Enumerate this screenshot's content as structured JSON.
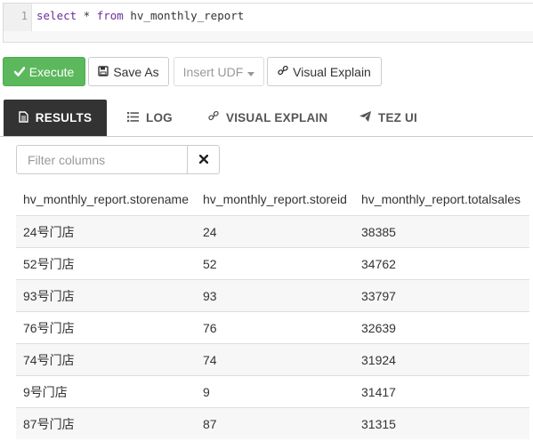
{
  "editor": {
    "line_number": "1",
    "tokens": {
      "select": "select",
      "star": " * ",
      "from": "from",
      "table": " hv_monthly_report"
    }
  },
  "toolbar": {
    "execute_label": "Execute",
    "save_as_label": "Save As",
    "insert_udf_label": "Insert UDF",
    "visual_explain_label": "Visual Explain"
  },
  "tabs": [
    {
      "label": "RESULTS",
      "active": true
    },
    {
      "label": "LOG"
    },
    {
      "label": "VISUAL EXPLAIN"
    },
    {
      "label": "TEZ UI"
    }
  ],
  "filter": {
    "placeholder": "Filter columns"
  },
  "table": {
    "headers": [
      "hv_monthly_report.storename",
      "hv_monthly_report.storeid",
      "hv_monthly_report.totalsales"
    ],
    "rows": [
      [
        "24号门店",
        "24",
        "38385"
      ],
      [
        "52号门店",
        "52",
        "34762"
      ],
      [
        "93号门店",
        "93",
        "33797"
      ],
      [
        "76号门店",
        "76",
        "32639"
      ],
      [
        "74号门店",
        "74",
        "31924"
      ],
      [
        "9号门店",
        "9",
        "31417"
      ],
      [
        "87号门店",
        "87",
        "31315"
      ]
    ]
  },
  "colors": {
    "execute_bg": "#5cb85c",
    "active_tab_bg": "#333333",
    "keyword": "#6a2ea0"
  },
  "icons": [
    "check-icon",
    "save-icon",
    "caret-down-icon",
    "link-icon",
    "file-icon",
    "list-icon",
    "send-icon",
    "close-icon"
  ]
}
